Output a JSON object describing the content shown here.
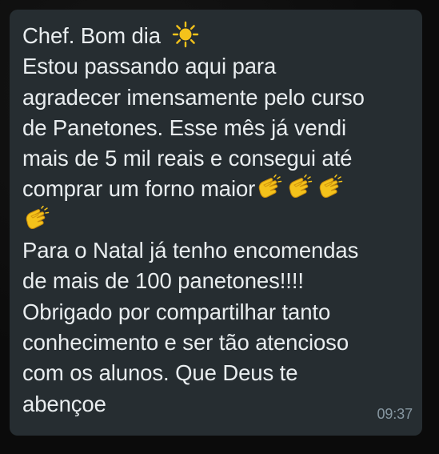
{
  "message": {
    "line1": "Chef. Bom dia",
    "line2": "Estou passando aqui para",
    "line3": "agradecer imensamente pelo curso",
    "line4": "de Panetones. Esse mês já vendi",
    "line5": "mais de 5 mil reais e consegui até",
    "line6": "comprar um forno maior",
    "line8": "Para o Natal já tenho encomendas",
    "line9": "de mais de 100 panetones!!!!",
    "line10": "Obrigado por compartilhar tanto",
    "line11": "conhecimento e ser tão atencioso",
    "line12": "com os alunos. Que Deus te",
    "line13": "abençoe",
    "time": "09:37"
  },
  "icons": {
    "sun": "sun-icon",
    "clap": "clapping-hands-icon"
  },
  "colors": {
    "bubble": "#262d31",
    "text": "#e9edef",
    "timestamp": "#8696a0",
    "emoji_yellow": "#f4c21b"
  }
}
